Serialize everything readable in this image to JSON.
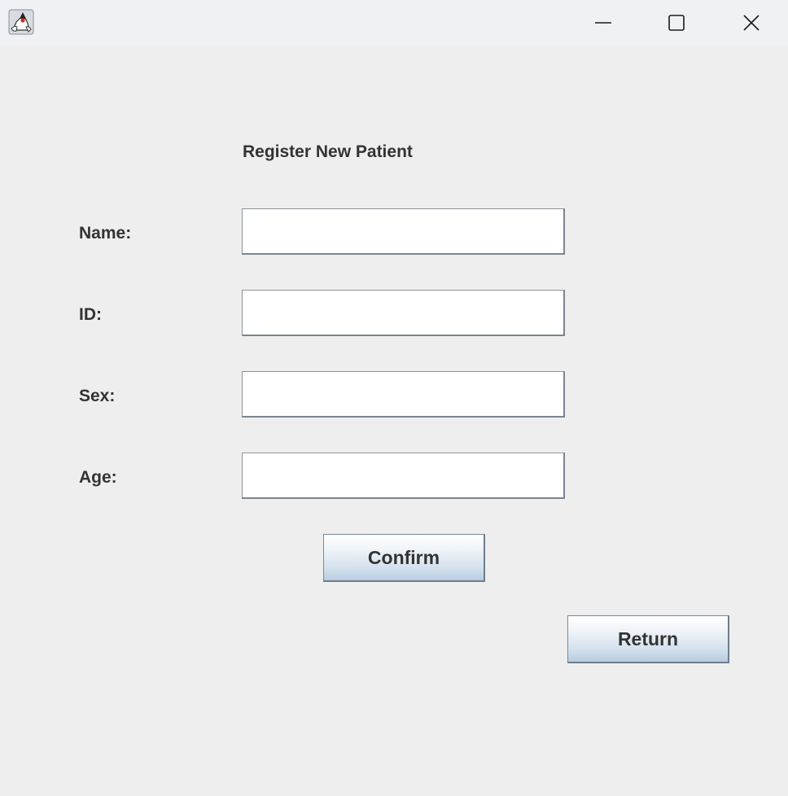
{
  "window": {
    "title": "",
    "app_icon": "java-duke-icon",
    "controls": {
      "minimize_icon": "minimize-icon",
      "maximize_icon": "maximize-icon",
      "close_icon": "close-icon"
    }
  },
  "form": {
    "heading": "Register New Patient",
    "fields": [
      {
        "label": "Name:",
        "value": ""
      },
      {
        "label": "ID:",
        "value": ""
      },
      {
        "label": "Sex:",
        "value": ""
      },
      {
        "label": "Age:",
        "value": ""
      }
    ],
    "confirm_label": "Confirm",
    "return_label": "Return"
  },
  "colors": {
    "window_background": "#eeeeee",
    "titlebar_background": "#f0f1f5",
    "text": "#333333",
    "button_gradient_top": "#ffffff",
    "button_gradient_bottom": "#b9cde0"
  }
}
